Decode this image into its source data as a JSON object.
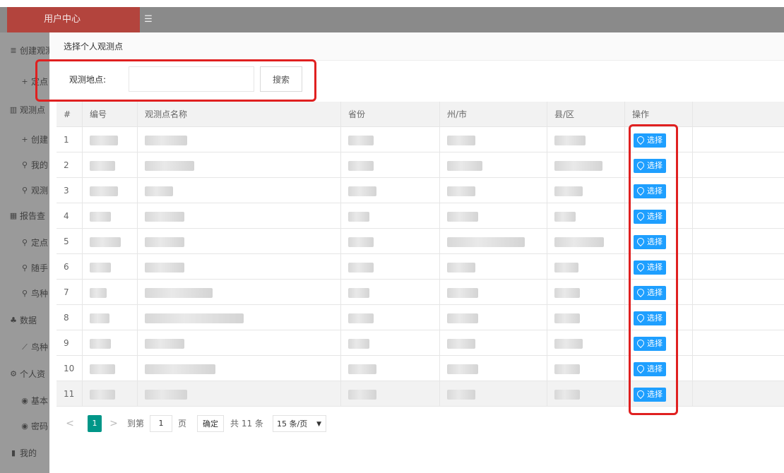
{
  "app": {
    "brand": "用户中心",
    "menu_toggle_icon": "menu-fold-icon"
  },
  "sidebar": {
    "items": [
      {
        "icon": "list-icon",
        "glyph": "≣",
        "label": "创建观测点",
        "sub": false
      },
      {
        "icon": "plus-icon",
        "glyph": "+",
        "label": "定点",
        "sub": true
      },
      {
        "icon": "map-icon",
        "glyph": "▥",
        "label": "观测点",
        "sub": false
      },
      {
        "icon": "plus-icon",
        "glyph": "+",
        "label": "创建",
        "sub": true
      },
      {
        "icon": "search-icon",
        "glyph": "⚲",
        "label": "我的",
        "sub": true
      },
      {
        "icon": "search-icon",
        "glyph": "⚲",
        "label": "观测",
        "sub": true
      },
      {
        "icon": "grid-icon",
        "glyph": "▦",
        "label": "报告查",
        "sub": false
      },
      {
        "icon": "search-icon",
        "glyph": "⚲",
        "label": "定点",
        "sub": true
      },
      {
        "icon": "search-icon",
        "glyph": "⚲",
        "label": "随手",
        "sub": true
      },
      {
        "icon": "search-icon",
        "glyph": "⚲",
        "label": "鸟种",
        "sub": true
      },
      {
        "icon": "share-icon",
        "glyph": "♣",
        "label": "数据",
        "sub": false
      },
      {
        "icon": "chart-line-icon",
        "glyph": "⟋",
        "label": "鸟种",
        "sub": true
      },
      {
        "icon": "gears-icon",
        "glyph": "⚙",
        "label": "个人资",
        "sub": false
      },
      {
        "icon": "user-circle-icon",
        "glyph": "◉",
        "label": "基本",
        "sub": true
      },
      {
        "icon": "user-circle-icon",
        "glyph": "◉",
        "label": "密码",
        "sub": true
      },
      {
        "icon": "bookmark-icon",
        "glyph": "▮",
        "label": "我的",
        "sub": false
      }
    ]
  },
  "modal": {
    "title": "选择个人观测点",
    "search": {
      "label": "观测地点:",
      "value": "",
      "placeholder": "",
      "button": "搜索"
    },
    "table": {
      "headers": [
        "#",
        "编号",
        "观测点名称",
        "省份",
        "州/市",
        "县/区",
        "操作"
      ],
      "select_label": "选择",
      "rows": [
        {
          "n": "1"
        },
        {
          "n": "2"
        },
        {
          "n": "3"
        },
        {
          "n": "4"
        },
        {
          "n": "5"
        },
        {
          "n": "6"
        },
        {
          "n": "7"
        },
        {
          "n": "8"
        },
        {
          "n": "9"
        },
        {
          "n": "10"
        },
        {
          "n": "11"
        }
      ]
    },
    "pagination": {
      "prev": "<",
      "current": "1",
      "next": ">",
      "goto_label": "到第",
      "goto_value": "1",
      "page_label": "页",
      "confirm": "确定",
      "total": "共 11 条",
      "page_size": "15 条/页"
    }
  },
  "colors": {
    "brand_bg": "#b3443d",
    "select_button": "#1e9fff",
    "pager_current": "#009688",
    "highlight_border": "#e02020"
  }
}
